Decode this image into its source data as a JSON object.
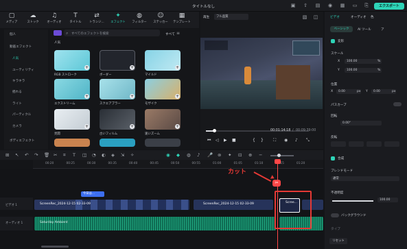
{
  "app": {
    "window_title": "タイトルなし",
    "export_label": "エクスポート"
  },
  "toolbar": {
    "items": [
      {
        "label": "メディア",
        "icon": "media-icon"
      },
      {
        "label": "ストック",
        "icon": "stock-icon"
      },
      {
        "label": "オーディオ",
        "icon": "audio-icon"
      },
      {
        "label": "タイトル",
        "icon": "title-icon"
      },
      {
        "label": "トランジ…",
        "icon": "transition-icon"
      },
      {
        "label": "エフェクト",
        "icon": "effect-icon",
        "active": true
      },
      {
        "label": "フィルター",
        "icon": "filter-icon"
      },
      {
        "label": "ステッカー",
        "icon": "sticker-icon"
      },
      {
        "label": "テンプレート",
        "icon": "template-icon"
      }
    ]
  },
  "sidebar": {
    "items": [
      "個人",
      "動画エフェクト",
      "人気",
      "ユーティリティ",
      "キラキラ",
      "揺れる",
      "ライト",
      "パーティクル",
      "カメラ",
      "ボディエフェクト"
    ],
    "selected": "人気"
  },
  "effects": {
    "search_placeholder": "すべてのエフェクトを検索",
    "filter_label": "すべて",
    "section_title": "人気",
    "cards": [
      {
        "label": "RGB ストローク"
      },
      {
        "label": "ボーダー"
      },
      {
        "label": "マイルド"
      },
      {
        "label": "エクストリーム"
      },
      {
        "label": "スクエアブラー"
      },
      {
        "label": "モザイク"
      },
      {
        "label": "見開"
      },
      {
        "label": "古いフィルム"
      },
      {
        "label": "速いズーム"
      }
    ]
  },
  "preview": {
    "player_label": "再生",
    "quality": "フル品質",
    "current_time": "00:01:14:18",
    "total_time": "00:09:39:00"
  },
  "right_panel": {
    "tabs": [
      "ビデオ",
      "オーディオ",
      "色"
    ],
    "subtabs": [
      "ベーシック",
      "AI ツール",
      "ア"
    ],
    "transform_label": "変形",
    "scale_label": "スケール",
    "x_label": "X",
    "y_label": "Y",
    "scale_x": "100.00",
    "scale_y": "100.00",
    "percent": "%",
    "position_label": "位置",
    "pos_x": "0.00",
    "pos_y": "0.00",
    "px": "px",
    "path_curve_label": "パスカーブ",
    "rotate_label": "回転",
    "rotate_value": "0.00°",
    "flip_label": "反転",
    "compose_label": "合成",
    "blend_label": "ブレンドモード",
    "blend_value": "通常",
    "opacity_label": "不透明度",
    "opacity_value": "100.00",
    "background_label": "バックグラウンド",
    "type_label": "タイプ",
    "reset_label": "リセット"
  },
  "timeline": {
    "ruler": [
      "00:20",
      "00:25",
      "00:30",
      "00:35",
      "00:40",
      "00:45",
      "00:50",
      "00:55",
      "01:00",
      "01:05",
      "01:10",
      "01:15",
      "01:20"
    ],
    "track_video_label": "ビデオ 1",
    "track_audio_label": "オーディオ 1",
    "clip1_name": "ScreenRec_2024-12-15 02-33-09",
    "clip2_name": "ScreenRec_2024-12-15 02-33-09",
    "clip3_name": "Scree...",
    "audio_name": "Saturday Ambient",
    "marker_label": "今日は...",
    "annotation": "カット"
  }
}
